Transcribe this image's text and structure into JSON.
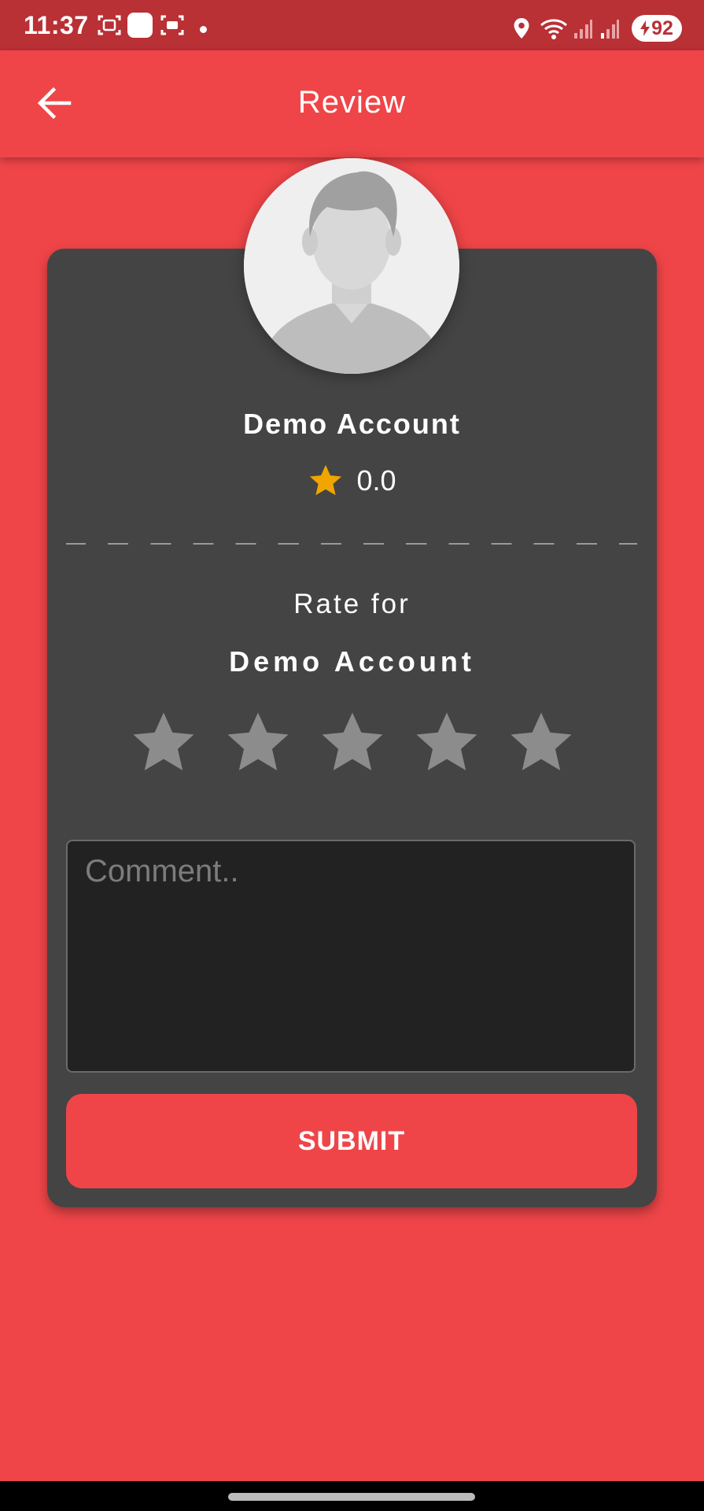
{
  "status_bar": {
    "time": "11:37",
    "battery": "92",
    "icons": [
      "screenshot-icon",
      "app-notification-icon",
      "screen-record-icon",
      "dot-icon",
      "location-icon",
      "wifi-icon",
      "signal-icon",
      "signal-icon",
      "battery-charging-icon"
    ]
  },
  "app_bar": {
    "title": "Review",
    "back_icon": "arrow-back-icon"
  },
  "profile": {
    "avatar_icon": "person-placeholder-icon",
    "name": "Demo Account",
    "rating": "0.0",
    "rating_icon": "star-icon"
  },
  "rate_section": {
    "label": "Rate for",
    "name": "Demo Account",
    "stars_total": 5,
    "stars_selected": 0
  },
  "comment": {
    "placeholder": "Comment..",
    "value": ""
  },
  "submit_label": "SUBMIT",
  "colors": {
    "primary": "#ef4548",
    "status_bar": "#b93035",
    "card": "#444444",
    "input_bg": "#222222",
    "star_gold": "#f0a500",
    "star_empty": "#8c8c8c"
  }
}
